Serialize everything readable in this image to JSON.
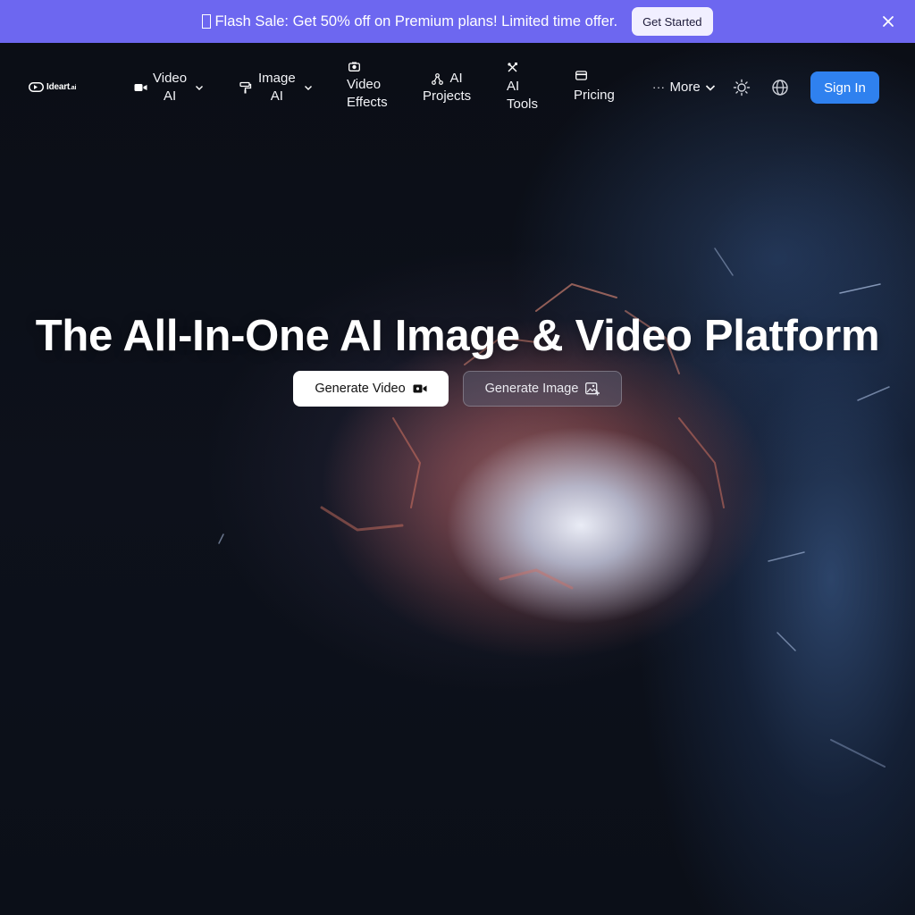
{
  "promo": {
    "text": "Flash Sale: Get 50% off on Premium plans! Limited time offer.",
    "cta": "Get Started"
  },
  "brand": {
    "name": "Ideart",
    "suffix": ".ai"
  },
  "nav": {
    "video_ai": {
      "line1": "Video",
      "line2": "AI"
    },
    "image_ai": {
      "line1": "Image",
      "line2": "AI"
    },
    "video_effects": {
      "line1": "Video",
      "line2": "Effects"
    },
    "ai_projects": {
      "line1": "AI",
      "line2": "Projects"
    },
    "ai_tools": {
      "line1": "AI",
      "line2": "Tools"
    },
    "pricing": "Pricing",
    "more": "More",
    "sign_in": "Sign In"
  },
  "hero": {
    "title": "The All-In-One AI Image & Video Platform",
    "generate_video": "Generate Video",
    "generate_image": "Generate Image"
  },
  "colors": {
    "banner": "#6d67f0",
    "sign_in": "#2f81ef",
    "background": "#0a0d14"
  }
}
